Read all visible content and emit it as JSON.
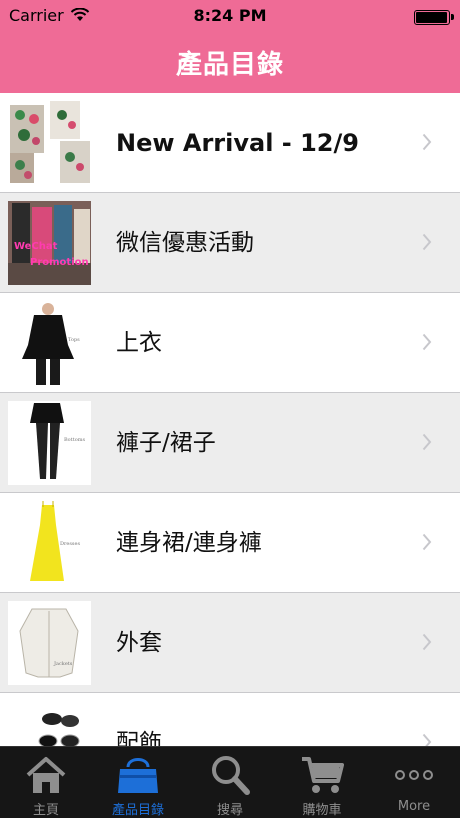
{
  "status_bar": {
    "carrier": "Carrier",
    "time": "8:24 PM",
    "battery_level": 1.0
  },
  "nav": {
    "title": "產品目錄"
  },
  "categories": [
    {
      "label": "New Arrival - 12/9"
    },
    {
      "label": "微信優惠活動",
      "thumb_text": [
        "WeChat",
        "Promotion"
      ]
    },
    {
      "label": "上衣",
      "thumb_text": "Tops"
    },
    {
      "label": "褲子/裙子",
      "thumb_text": "Bottoms"
    },
    {
      "label": "連身裙/連身褲",
      "thumb_text": "Dresses"
    },
    {
      "label": "外套",
      "thumb_text": "Jackets"
    },
    {
      "label": "配飾"
    }
  ],
  "tabs": [
    {
      "label": "主頁",
      "icon": "home-icon"
    },
    {
      "label": "產品目錄",
      "icon": "bag-icon",
      "active": true
    },
    {
      "label": "搜尋",
      "icon": "search-icon"
    },
    {
      "label": "購物車",
      "icon": "cart-icon"
    },
    {
      "label": "More",
      "icon": "more-icon"
    }
  ],
  "colors": {
    "header": "#ef6b96",
    "tab_active": "#1d6fd8",
    "tab_inactive": "#8e8e8e",
    "row_alt": "#ededed"
  }
}
